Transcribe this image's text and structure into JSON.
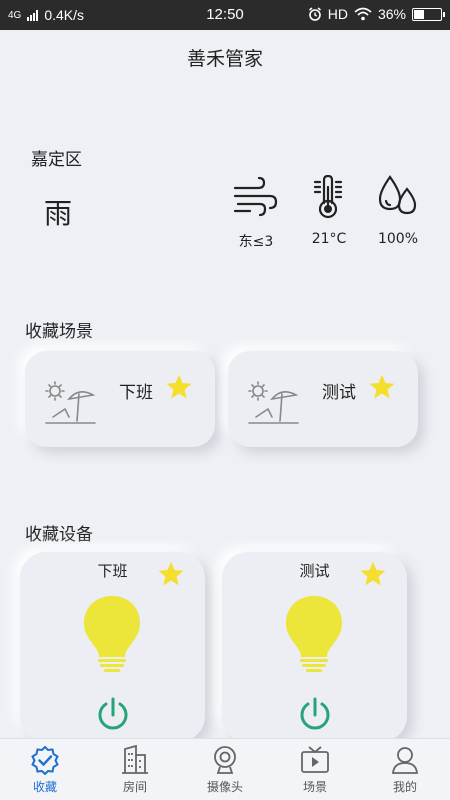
{
  "status_bar": {
    "network": "4G",
    "speed": "0.4K/s",
    "time": "12:50",
    "hd": "HD",
    "battery_percent": "36%",
    "battery_level": 0.36
  },
  "app": {
    "title": "善禾管家"
  },
  "weather": {
    "location": "嘉定区",
    "condition": "雨",
    "wind": "东≤3",
    "temperature": "21°C",
    "humidity": "100%"
  },
  "favorite_scenes": {
    "title": "收藏场景",
    "items": [
      {
        "label": "下班",
        "icon": "beach-umbrella-icon",
        "starred": true
      },
      {
        "label": "测试",
        "icon": "beach-umbrella-icon",
        "starred": true
      }
    ]
  },
  "favorite_devices": {
    "title": "收藏设备",
    "items": [
      {
        "label": "下班",
        "icon": "light-bulb-icon",
        "starred": true
      },
      {
        "label": "测试",
        "icon": "light-bulb-icon",
        "starred": true
      }
    ]
  },
  "bottom_nav": {
    "items": [
      {
        "label": "收藏",
        "icon": "favorites-badge-icon",
        "active": true
      },
      {
        "label": "房间",
        "icon": "building-icon",
        "active": false
      },
      {
        "label": "摄像头",
        "icon": "camera-icon",
        "active": false
      },
      {
        "label": "场景",
        "icon": "tv-play-icon",
        "active": false
      },
      {
        "label": "我的",
        "icon": "user-icon",
        "active": false
      }
    ]
  },
  "colors": {
    "accent_blue": "#1e6fcf",
    "star_yellow": "#f5df2e",
    "bulb_yellow": "#ece53a",
    "power_green": "#27a37a"
  }
}
